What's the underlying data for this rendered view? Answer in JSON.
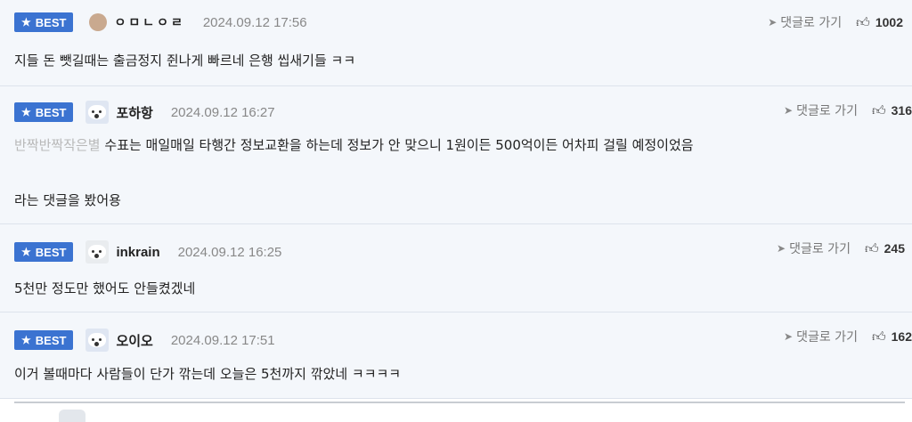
{
  "badge_label": "BEST",
  "reply_link_label": "댓글로 가기",
  "comments": [
    {
      "nickname": "ㅇㅁㄴㅇㄹ",
      "date": "2024.09.12 17:56",
      "likes": "1002",
      "text": "지들 돈 뺏길때는 출금정지 쥔나게 빠르네 은행 씹새기들 ㅋㅋ"
    },
    {
      "nickname": "포하항",
      "date": "2024.09.12 16:27",
      "likes": "316",
      "mention": "반짝반짝작은별",
      "text": "수표는 매일매일 타행간 정보교환을 하는데 정보가 안 맞으니 1원이든 500억이든 어차피 걸릴 예정이었음",
      "text2": "라는 댓글을 봤어용"
    },
    {
      "nickname": "inkrain",
      "date": "2024.09.12 16:25",
      "likes": "245",
      "text": "5천만 정도만 했어도 안들켰겠네"
    },
    {
      "nickname": "오이오",
      "date": "2024.09.12 17:51",
      "likes": "162",
      "text": "이거 볼때마다 사람들이 단가 깎는데 오늘은 5천까지 깎았네 ㅋㅋㅋㅋ"
    }
  ],
  "colors": {
    "best_badge": "#3b73d1",
    "row_background": "#f4f7fb",
    "mention": "#b9b9b9"
  }
}
